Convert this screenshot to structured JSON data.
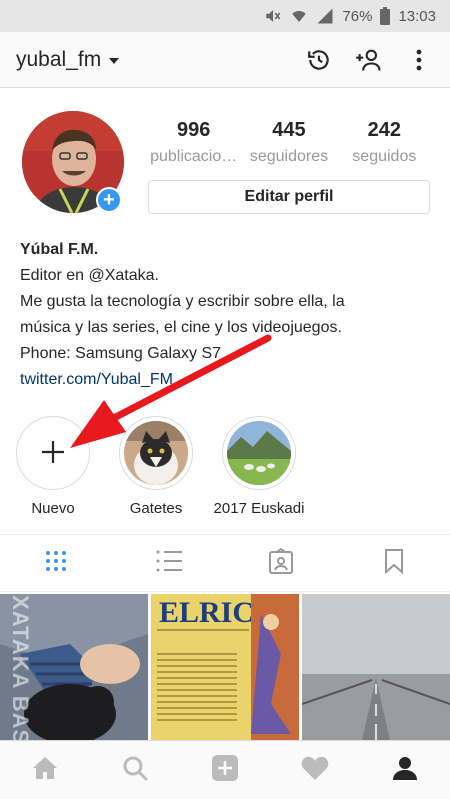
{
  "status_bar": {
    "battery_percent": "76%",
    "time": "13:03",
    "icons": [
      "mute-icon",
      "wifi-icon",
      "signal-icon",
      "battery-icon"
    ]
  },
  "header": {
    "username": "yubal_fm",
    "icons": [
      "history-icon",
      "add-person-icon",
      "more-icon"
    ]
  },
  "profile": {
    "stats": [
      {
        "value": "996",
        "label": "publicacio…"
      },
      {
        "value": "445",
        "label": "seguidores"
      },
      {
        "value": "242",
        "label": "seguidos"
      }
    ],
    "edit_button": "Editar perfil"
  },
  "bio": {
    "name": "Yúbal F.M.",
    "lines": [
      "Editor en @Xataka.",
      "Me gusta la tecnología y escribir sobre ella, la",
      "música y las series, el cine y los videojuegos.",
      "Phone: Samsung Galaxy S7"
    ],
    "link": "twitter.com/Yubal_FM"
  },
  "highlights": [
    {
      "label": "Nuevo"
    },
    {
      "label": "Gatetes"
    },
    {
      "label": "2017 Euskadi"
    }
  ],
  "watermark": "XATAKA BASICS",
  "colors": {
    "accent_blue": "#3897f0",
    "annotation_red": "#e8191c",
    "link": "#003569"
  }
}
